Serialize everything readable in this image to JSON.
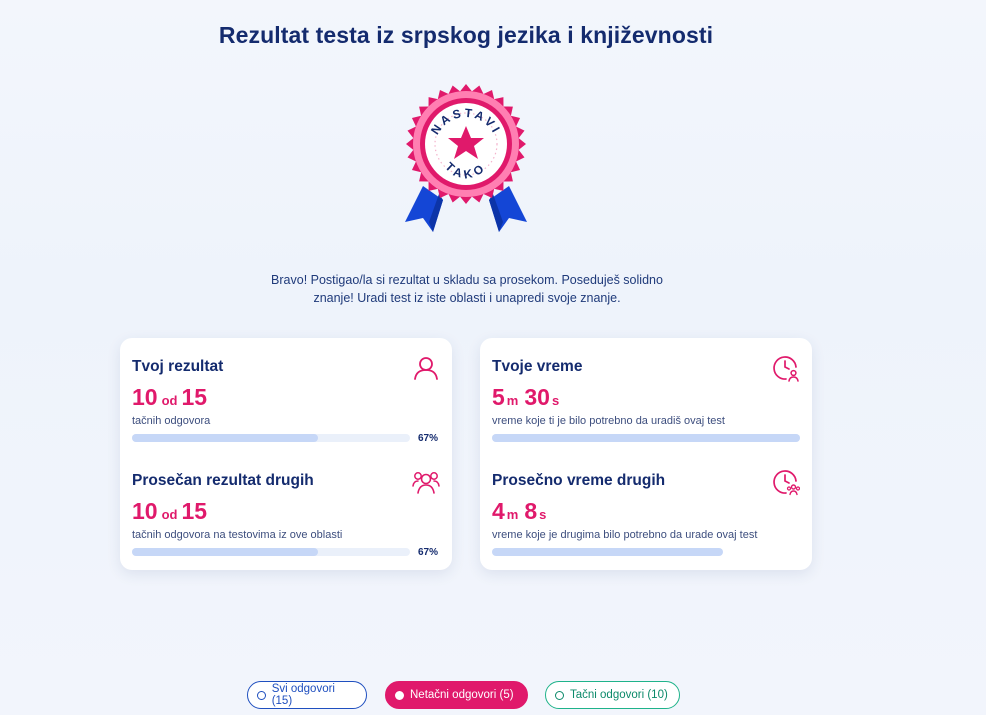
{
  "page": {
    "title": "Rezultat testa iz srpskog jezika i književnosti"
  },
  "badge": {
    "top_text": "NASTAVI",
    "bottom_text": "TAKO",
    "colors": {
      "pink": "#e0196b",
      "ribbon": "#1446d6",
      "ring": "#ff7fb2"
    }
  },
  "message": {
    "line1": "Bravo! Postigao/la si rezultat u skladu sa prosekom. Poseduješ solidno",
    "line2": "znanje! Uradi test iz iste oblasti i unapredi svoje znanje."
  },
  "score_card": {
    "yours": {
      "title": "Tvoj rezultat",
      "icon": "user-icon",
      "correct": "10",
      "of": "od",
      "total": "15",
      "caption": "tačnih odgovora",
      "progress": 0.67,
      "progress_label": "67%"
    },
    "others": {
      "title": "Prosečan rezultat drugih",
      "icon": "users-icon",
      "correct": "10",
      "of": "od",
      "total": "15",
      "caption": "tačnih odgovora na testovima iz ove oblasti",
      "progress": 0.67,
      "progress_label": "67%"
    }
  },
  "time_card": {
    "yours": {
      "title": "Tvoje vreme",
      "icon": "clock-user-icon",
      "minutes": "5",
      "min_unit": "m",
      "seconds": "30",
      "sec_unit": "s",
      "caption": "vreme koje ti je bilo potrebno da uradiš ovaj test",
      "progress": 1.0
    },
    "others": {
      "title": "Prosečno vreme drugih",
      "icon": "clock-users-icon",
      "minutes": "4",
      "min_unit": "m",
      "seconds": "8",
      "sec_unit": "s",
      "caption": "vreme koje je drugima bilo potrebno da urade ovaj test",
      "progress": 0.75
    }
  },
  "filters": [
    {
      "label": "Svi odgovori (15)",
      "selected": false
    },
    {
      "label": "Netačni odgovori (5)",
      "selected": true
    },
    {
      "label": "Tačni odgovori (10)",
      "selected": false
    }
  ]
}
